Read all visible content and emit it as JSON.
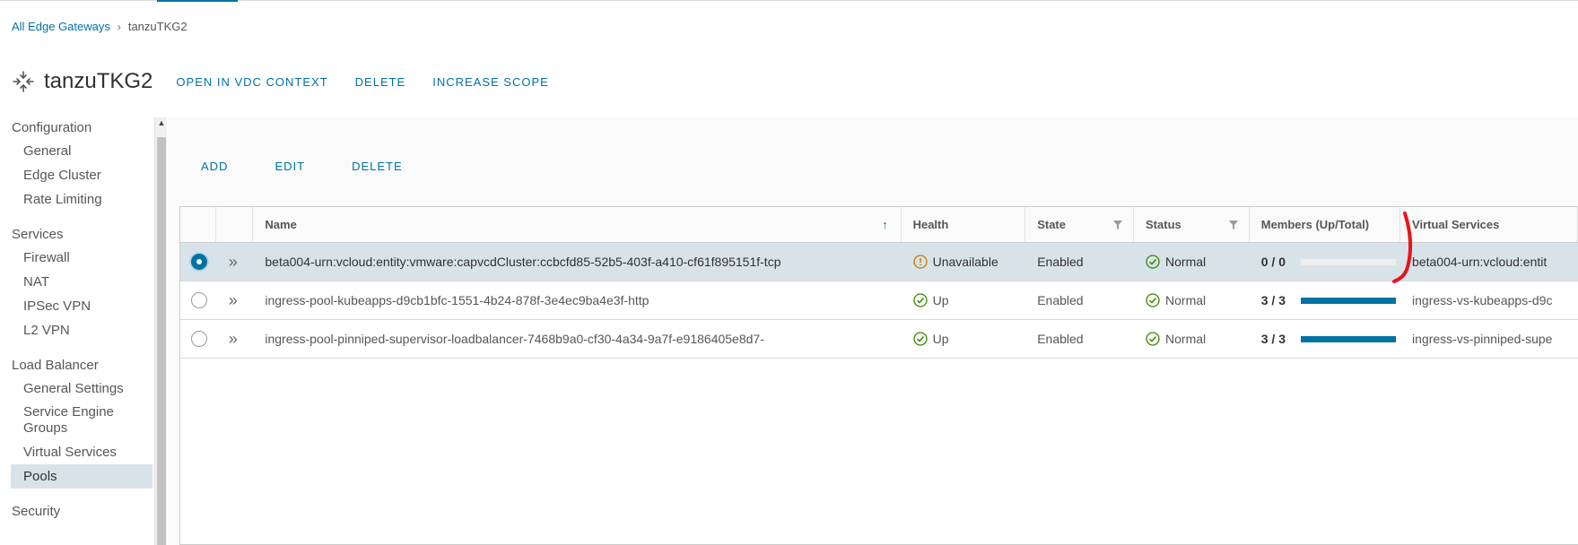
{
  "breadcrumb": {
    "parent": "All Edge Gateways",
    "current": "tanzuTKG2"
  },
  "header": {
    "title": "tanzuTKG2",
    "icon": "edge-gateway-icon",
    "actions": [
      "OPEN IN VDC CONTEXT",
      "DELETE",
      "INCREASE SCOPE"
    ]
  },
  "sidebar": {
    "groups": [
      {
        "label": "Configuration",
        "items": [
          "General",
          "Edge Cluster",
          "Rate Limiting"
        ]
      },
      {
        "label": "Services",
        "items": [
          "Firewall",
          "NAT",
          "IPSec VPN",
          "L2 VPN"
        ]
      },
      {
        "label": "Load Balancer",
        "items": [
          "General Settings",
          "Service Engine Groups",
          "Virtual Services",
          "Pools"
        ]
      },
      {
        "label": "Security",
        "items": []
      }
    ],
    "active_item": "Pools"
  },
  "toolbar": {
    "add": "ADD",
    "edit": "EDIT",
    "delete": "DELETE"
  },
  "grid": {
    "columns": {
      "name": "Name",
      "health": "Health",
      "state": "State",
      "status": "Status",
      "members": "Members (Up/Total)",
      "virtual_services": "Virtual Services"
    },
    "rows": [
      {
        "selected": true,
        "name": "beta004-urn:vcloud:entity:vmware:capvcdCluster:ccbcfd85-52b5-403f-a410-cf61f895151f-tcp",
        "health": "Unavailable",
        "health_icon": "warning-icon",
        "state": "Enabled",
        "status": "Normal",
        "members": "0 / 0",
        "members_fraction": 0,
        "virtual_services": "beta004-urn:vcloud:entit"
      },
      {
        "selected": false,
        "name": "ingress-pool-kubeapps-d9cb1bfc-1551-4b24-878f-3e4ec9ba4e3f-http",
        "health": "Up",
        "health_icon": "check-circle-icon",
        "state": "Enabled",
        "status": "Normal",
        "members": "3 / 3",
        "members_fraction": 1,
        "virtual_services": "ingress-vs-kubeapps-d9c"
      },
      {
        "selected": false,
        "name": "ingress-pool-pinniped-supervisor-loadbalancer-7468b9a0-cf30-4a34-9a7f-e9186405e8d7-",
        "health": "Up",
        "health_icon": "check-circle-icon",
        "state": "Enabled",
        "status": "Normal",
        "members": "3 / 3",
        "members_fraction": 1,
        "virtual_services": "ingress-vs-pinniped-supe"
      }
    ]
  },
  "colors": {
    "accent": "#0072a3",
    "ok": "#3c8500",
    "warning": "#c27b00",
    "annotation": "#e8141b"
  }
}
